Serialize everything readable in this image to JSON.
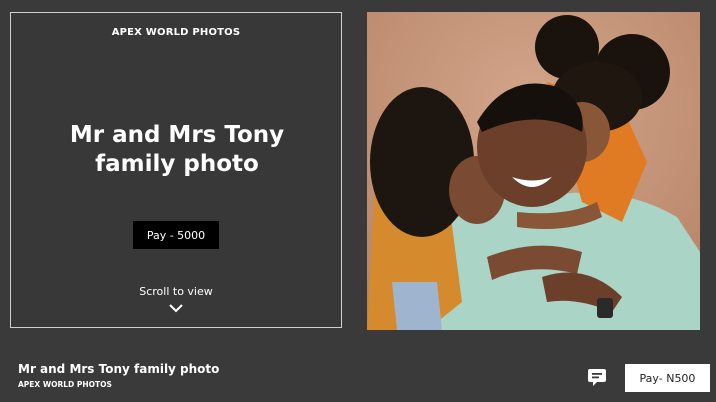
{
  "info_panel": {
    "brand": "APEX WORLD PHOTOS",
    "title": "Mr and Mrs Tony family photo",
    "pay_label": "Pay - 5000",
    "scroll_hint": "Scroll to view",
    "scroll_icon": "chevron-down-icon"
  },
  "photo": {
    "subject": "family-photo"
  },
  "bottom_bar": {
    "title": "Mr and Mrs Tony family photo",
    "brand": "APEX WORLD PHOTOS",
    "chat_icon": "chat-icon",
    "pay_label": "Pay- N500"
  },
  "colors": {
    "background": "#3a3a3a",
    "panel_border": "#cfcfcf",
    "primary_button": "#000000",
    "secondary_button": "#ffffff",
    "photo_backdrop": "#c9977c"
  }
}
